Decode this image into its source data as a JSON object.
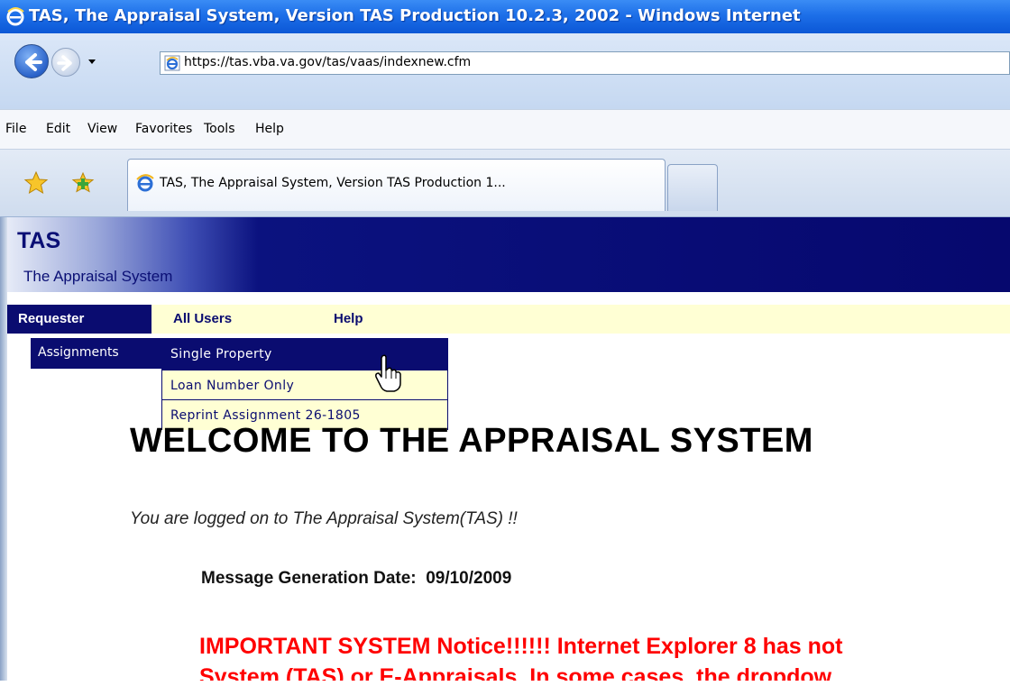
{
  "window": {
    "title": "TAS, The Appraisal System, Version TAS Production 10.2.3, 2002 - Windows Internet"
  },
  "address_bar": {
    "url": "https://tas.vba.va.gov/tas/vaas/indexnew.cfm"
  },
  "menu": {
    "items": [
      "File",
      "Edit",
      "View",
      "Favorites",
      "Tools",
      "Help"
    ]
  },
  "tabs": {
    "active_label": "TAS, The Appraisal System, Version TAS Production 1..."
  },
  "banner": {
    "title": "TAS",
    "subtitle": "The Appraisal System"
  },
  "tas_nav": {
    "requester": "Requester",
    "all_users": "All Users",
    "help": "Help"
  },
  "submenu": {
    "assignments": "Assignments"
  },
  "dropdown": {
    "items": [
      "Single Property",
      "Loan Number Only",
      "Reprint Assignment 26-1805"
    ],
    "hovered_item": "Single Property"
  },
  "content": {
    "welcome": "WELCOME TO THE APPRAISAL SYSTEM",
    "logged_on": "You are logged on to The Appraisal System(TAS) !!",
    "message_date_label": "Message Generation Date:",
    "message_date_value": "09/10/2009",
    "notice_line1": "IMPORTANT SYSTEM Notice!!!!!! Internet Explorer 8 has not",
    "notice_line2": "System (TAS) or E-Appraisals. In some cases, the dropdow"
  },
  "colors": {
    "banner_navy": "#06086e",
    "nav_background": "#ffffd4",
    "notice_red": "#ff0000",
    "titlebar_blue": "#1d6fe8"
  },
  "icons": [
    "ie-logo-icon",
    "back-arrow-icon",
    "forward-arrow-icon",
    "chevron-down-icon",
    "ie-page-icon",
    "favorites-star-icon",
    "add-favorite-icon",
    "hand-cursor-icon"
  ]
}
